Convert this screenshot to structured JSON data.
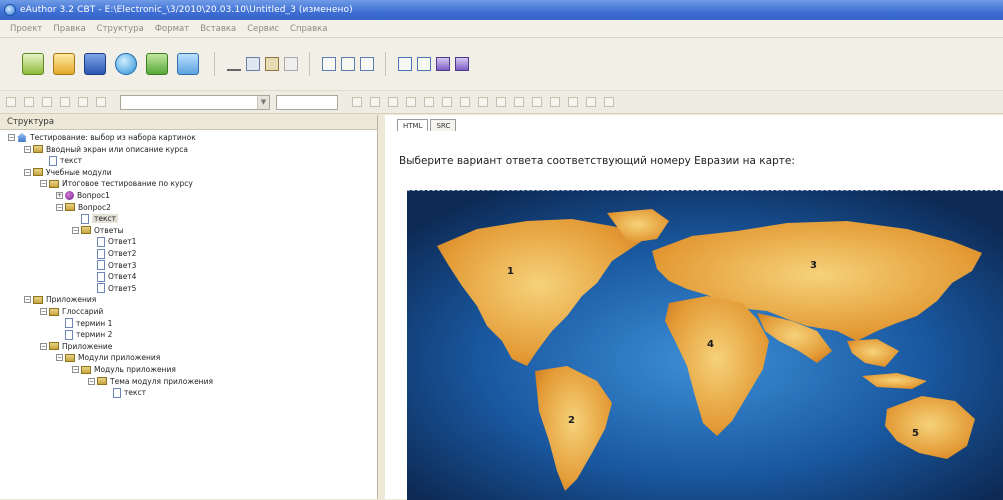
{
  "window": {
    "title": "eAuthor 3.2 CBT - E:\\Electronic_\\3/2010\\20.03.10\\Untitled_3 (изменено)"
  },
  "menu": {
    "items": [
      "Проект",
      "Правка",
      "Структура",
      "Формат",
      "Вставка",
      "Сервис",
      "Справка"
    ]
  },
  "left_panel": {
    "header": "Структура",
    "tree": [
      {
        "label": "Тестирование: выбор из набора картинок",
        "level": 0,
        "icon": "home-icon",
        "expander": "−"
      },
      {
        "label": "Вводный экран или описание курса",
        "level": 1,
        "icon": "folder-icon",
        "expander": "−"
      },
      {
        "label": "текст",
        "level": 2,
        "icon": "document-icon",
        "expander": ""
      },
      {
        "label": "Учебные модули",
        "level": 1,
        "icon": "folder-icon",
        "expander": "−"
      },
      {
        "label": "Итоговое тестирование по курсу",
        "level": 2,
        "icon": "folder-icon",
        "expander": "−"
      },
      {
        "label": "Вопрос1",
        "level": 3,
        "icon": "question-icon",
        "expander": "+"
      },
      {
        "label": "Вопрос2",
        "level": 3,
        "icon": "folder-icon",
        "expander": "−"
      },
      {
        "label": "текст",
        "level": 4,
        "icon": "document-icon",
        "expander": "",
        "selected": true
      },
      {
        "label": "Ответы",
        "level": 4,
        "icon": "folder-icon",
        "expander": "−"
      },
      {
        "label": "Ответ1",
        "level": 5,
        "icon": "document-icon",
        "expander": ""
      },
      {
        "label": "Ответ2",
        "level": 5,
        "icon": "document-icon",
        "expander": ""
      },
      {
        "label": "Ответ3",
        "level": 5,
        "icon": "document-icon",
        "expander": ""
      },
      {
        "label": "Ответ4",
        "level": 5,
        "icon": "document-icon",
        "expander": ""
      },
      {
        "label": "Ответ5",
        "level": 5,
        "icon": "document-icon",
        "expander": ""
      },
      {
        "label": "Приложения",
        "level": 1,
        "icon": "folder-icon",
        "expander": "−"
      },
      {
        "label": "Глоссарий",
        "level": 2,
        "icon": "folder-icon",
        "expander": "−"
      },
      {
        "label": "термин 1",
        "level": 3,
        "icon": "document-icon",
        "expander": ""
      },
      {
        "label": "термин 2",
        "level": 3,
        "icon": "document-icon",
        "expander": ""
      },
      {
        "label": "Приложение",
        "level": 2,
        "icon": "folder-icon",
        "expander": "−"
      },
      {
        "label": "Модули приложения",
        "level": 3,
        "icon": "folder-icon",
        "expander": "−"
      },
      {
        "label": "Модуль приложения",
        "level": 4,
        "icon": "folder-icon",
        "expander": "−"
      },
      {
        "label": "Тема модуля приложения",
        "level": 5,
        "icon": "folder-icon",
        "expander": "−"
      },
      {
        "label": "текст",
        "level": 6,
        "icon": "document-icon",
        "expander": ""
      }
    ]
  },
  "right_panel": {
    "tabs": [
      "HTML",
      "SRC"
    ],
    "active_tab": "HTML",
    "question_text": "Выберите вариант ответа соответствующий номеру Евразии на карте:",
    "map_labels": [
      "1",
      "2",
      "3",
      "4",
      "5"
    ]
  },
  "colors": {
    "ocean": "#1d4f8f",
    "land": "#e6a23c",
    "titlebar": "#3e6fd4"
  }
}
